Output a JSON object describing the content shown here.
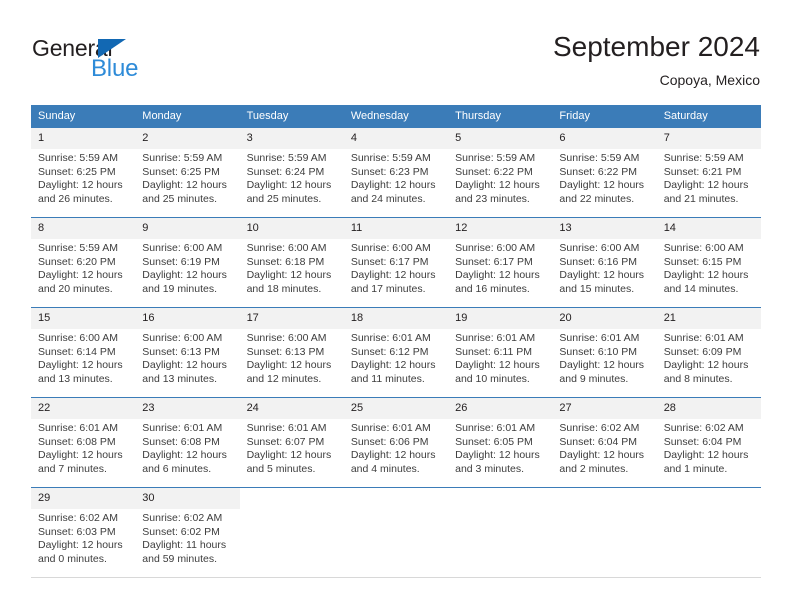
{
  "branding": {
    "name_part1": "General",
    "name_part2": "Blue",
    "triangle_icon": "triangle-icon"
  },
  "header": {
    "title": "September 2024",
    "subtitle": "Copoya, Mexico"
  },
  "colors": {
    "header_blue": "#3b7cb8",
    "logo_blue": "#2e8bd8",
    "triangle_blue": "#1268b3",
    "daynum_bg": "#f2f2f2",
    "text": "#231f20"
  },
  "weekdays": [
    "Sunday",
    "Monday",
    "Tuesday",
    "Wednesday",
    "Thursday",
    "Friday",
    "Saturday"
  ],
  "weeks": [
    [
      {
        "day": "1",
        "sunrise": "Sunrise: 5:59 AM",
        "sunset": "Sunset: 6:25 PM",
        "daylight1": "Daylight: 12 hours",
        "daylight2": "and 26 minutes."
      },
      {
        "day": "2",
        "sunrise": "Sunrise: 5:59 AM",
        "sunset": "Sunset: 6:25 PM",
        "daylight1": "Daylight: 12 hours",
        "daylight2": "and 25 minutes."
      },
      {
        "day": "3",
        "sunrise": "Sunrise: 5:59 AM",
        "sunset": "Sunset: 6:24 PM",
        "daylight1": "Daylight: 12 hours",
        "daylight2": "and 25 minutes."
      },
      {
        "day": "4",
        "sunrise": "Sunrise: 5:59 AM",
        "sunset": "Sunset: 6:23 PM",
        "daylight1": "Daylight: 12 hours",
        "daylight2": "and 24 minutes."
      },
      {
        "day": "5",
        "sunrise": "Sunrise: 5:59 AM",
        "sunset": "Sunset: 6:22 PM",
        "daylight1": "Daylight: 12 hours",
        "daylight2": "and 23 minutes."
      },
      {
        "day": "6",
        "sunrise": "Sunrise: 5:59 AM",
        "sunset": "Sunset: 6:22 PM",
        "daylight1": "Daylight: 12 hours",
        "daylight2": "and 22 minutes."
      },
      {
        "day": "7",
        "sunrise": "Sunrise: 5:59 AM",
        "sunset": "Sunset: 6:21 PM",
        "daylight1": "Daylight: 12 hours",
        "daylight2": "and 21 minutes."
      }
    ],
    [
      {
        "day": "8",
        "sunrise": "Sunrise: 5:59 AM",
        "sunset": "Sunset: 6:20 PM",
        "daylight1": "Daylight: 12 hours",
        "daylight2": "and 20 minutes."
      },
      {
        "day": "9",
        "sunrise": "Sunrise: 6:00 AM",
        "sunset": "Sunset: 6:19 PM",
        "daylight1": "Daylight: 12 hours",
        "daylight2": "and 19 minutes."
      },
      {
        "day": "10",
        "sunrise": "Sunrise: 6:00 AM",
        "sunset": "Sunset: 6:18 PM",
        "daylight1": "Daylight: 12 hours",
        "daylight2": "and 18 minutes."
      },
      {
        "day": "11",
        "sunrise": "Sunrise: 6:00 AM",
        "sunset": "Sunset: 6:17 PM",
        "daylight1": "Daylight: 12 hours",
        "daylight2": "and 17 minutes."
      },
      {
        "day": "12",
        "sunrise": "Sunrise: 6:00 AM",
        "sunset": "Sunset: 6:17 PM",
        "daylight1": "Daylight: 12 hours",
        "daylight2": "and 16 minutes."
      },
      {
        "day": "13",
        "sunrise": "Sunrise: 6:00 AM",
        "sunset": "Sunset: 6:16 PM",
        "daylight1": "Daylight: 12 hours",
        "daylight2": "and 15 minutes."
      },
      {
        "day": "14",
        "sunrise": "Sunrise: 6:00 AM",
        "sunset": "Sunset: 6:15 PM",
        "daylight1": "Daylight: 12 hours",
        "daylight2": "and 14 minutes."
      }
    ],
    [
      {
        "day": "15",
        "sunrise": "Sunrise: 6:00 AM",
        "sunset": "Sunset: 6:14 PM",
        "daylight1": "Daylight: 12 hours",
        "daylight2": "and 13 minutes."
      },
      {
        "day": "16",
        "sunrise": "Sunrise: 6:00 AM",
        "sunset": "Sunset: 6:13 PM",
        "daylight1": "Daylight: 12 hours",
        "daylight2": "and 13 minutes."
      },
      {
        "day": "17",
        "sunrise": "Sunrise: 6:00 AM",
        "sunset": "Sunset: 6:13 PM",
        "daylight1": "Daylight: 12 hours",
        "daylight2": "and 12 minutes."
      },
      {
        "day": "18",
        "sunrise": "Sunrise: 6:01 AM",
        "sunset": "Sunset: 6:12 PM",
        "daylight1": "Daylight: 12 hours",
        "daylight2": "and 11 minutes."
      },
      {
        "day": "19",
        "sunrise": "Sunrise: 6:01 AM",
        "sunset": "Sunset: 6:11 PM",
        "daylight1": "Daylight: 12 hours",
        "daylight2": "and 10 minutes."
      },
      {
        "day": "20",
        "sunrise": "Sunrise: 6:01 AM",
        "sunset": "Sunset: 6:10 PM",
        "daylight1": "Daylight: 12 hours",
        "daylight2": "and 9 minutes."
      },
      {
        "day": "21",
        "sunrise": "Sunrise: 6:01 AM",
        "sunset": "Sunset: 6:09 PM",
        "daylight1": "Daylight: 12 hours",
        "daylight2": "and 8 minutes."
      }
    ],
    [
      {
        "day": "22",
        "sunrise": "Sunrise: 6:01 AM",
        "sunset": "Sunset: 6:08 PM",
        "daylight1": "Daylight: 12 hours",
        "daylight2": "and 7 minutes."
      },
      {
        "day": "23",
        "sunrise": "Sunrise: 6:01 AM",
        "sunset": "Sunset: 6:08 PM",
        "daylight1": "Daylight: 12 hours",
        "daylight2": "and 6 minutes."
      },
      {
        "day": "24",
        "sunrise": "Sunrise: 6:01 AM",
        "sunset": "Sunset: 6:07 PM",
        "daylight1": "Daylight: 12 hours",
        "daylight2": "and 5 minutes."
      },
      {
        "day": "25",
        "sunrise": "Sunrise: 6:01 AM",
        "sunset": "Sunset: 6:06 PM",
        "daylight1": "Daylight: 12 hours",
        "daylight2": "and 4 minutes."
      },
      {
        "day": "26",
        "sunrise": "Sunrise: 6:01 AM",
        "sunset": "Sunset: 6:05 PM",
        "daylight1": "Daylight: 12 hours",
        "daylight2": "and 3 minutes."
      },
      {
        "day": "27",
        "sunrise": "Sunrise: 6:02 AM",
        "sunset": "Sunset: 6:04 PM",
        "daylight1": "Daylight: 12 hours",
        "daylight2": "and 2 minutes."
      },
      {
        "day": "28",
        "sunrise": "Sunrise: 6:02 AM",
        "sunset": "Sunset: 6:04 PM",
        "daylight1": "Daylight: 12 hours",
        "daylight2": "and 1 minute."
      }
    ],
    [
      {
        "day": "29",
        "sunrise": "Sunrise: 6:02 AM",
        "sunset": "Sunset: 6:03 PM",
        "daylight1": "Daylight: 12 hours",
        "daylight2": "and 0 minutes."
      },
      {
        "day": "30",
        "sunrise": "Sunrise: 6:02 AM",
        "sunset": "Sunset: 6:02 PM",
        "daylight1": "Daylight: 11 hours",
        "daylight2": "and 59 minutes."
      },
      null,
      null,
      null,
      null,
      null
    ]
  ]
}
